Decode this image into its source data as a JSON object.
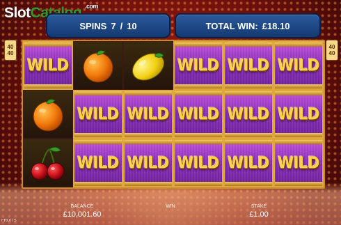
{
  "logo": {
    "part1": "Slot",
    "part2": "Catalog",
    "suffix": ".com"
  },
  "spins": {
    "label": "SPINS",
    "current": "7",
    "separator": "/",
    "total": "10"
  },
  "total_win": {
    "label": "TOTAL WIN:",
    "value": "£18.10"
  },
  "multiplier_badge": {
    "top": "40",
    "bottom": "40"
  },
  "reels": [
    [
      "wild",
      "orange",
      "lemon",
      "wild",
      "wild",
      "wild"
    ],
    [
      "orange",
      "wild",
      "wild",
      "wild",
      "wild",
      "wild"
    ],
    [
      "cherry",
      "wild",
      "wild",
      "wild",
      "wild",
      "wild"
    ]
  ],
  "wild_label": "WILD",
  "footer": {
    "balance_label": "BALANCE",
    "balance_value": "£10,001.60",
    "win_label": "WIN",
    "stake_label": "STAKE",
    "stake_value": "£1.00",
    "corner_text": "FRUITS"
  },
  "colors": {
    "panel": "#1e4a88",
    "wild_bg": "#8a2fb8",
    "wild_text": "#ffd24a",
    "frame": "#c98a2a"
  }
}
